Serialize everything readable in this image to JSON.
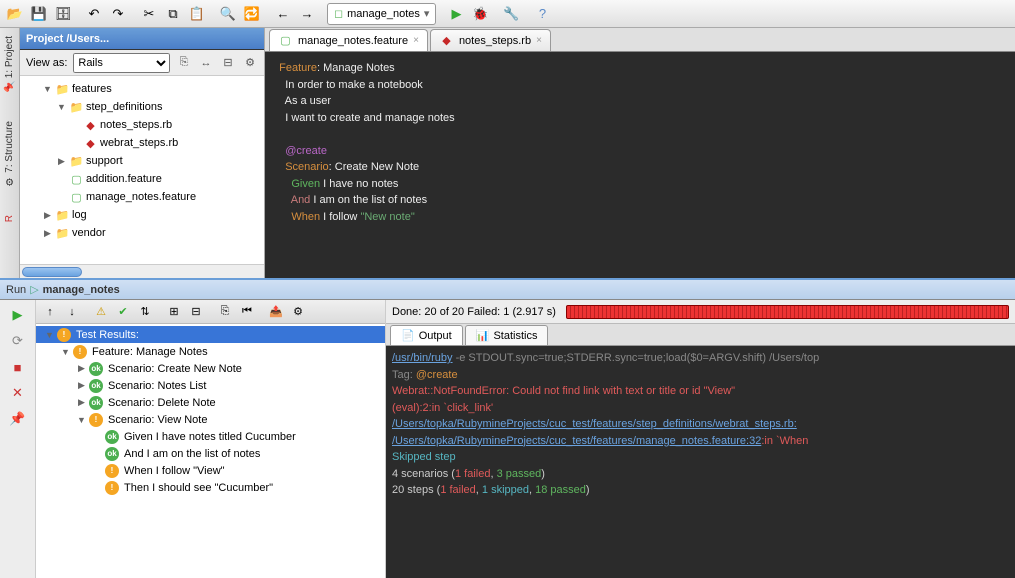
{
  "toolbar": {
    "run_config": "manage_notes"
  },
  "project": {
    "header": "Project /Users...",
    "view_as_label": "View as:",
    "view_as_value": "Rails",
    "tree": [
      {
        "d": 1,
        "exp": "▼",
        "icon": "folder",
        "label": "features"
      },
      {
        "d": 2,
        "exp": "▼",
        "icon": "folder",
        "label": "step_definitions"
      },
      {
        "d": 3,
        "exp": "",
        "icon": "ruby",
        "label": "notes_steps.rb"
      },
      {
        "d": 3,
        "exp": "",
        "icon": "ruby",
        "label": "webrat_steps.rb"
      },
      {
        "d": 2,
        "exp": "▶",
        "icon": "folder",
        "label": "support"
      },
      {
        "d": 2,
        "exp": "",
        "icon": "feature",
        "label": "addition.feature"
      },
      {
        "d": 2,
        "exp": "",
        "icon": "feature",
        "label": "manage_notes.feature"
      },
      {
        "d": 1,
        "exp": "▶",
        "icon": "folder",
        "label": "log"
      },
      {
        "d": 1,
        "exp": "▶",
        "icon": "folder-y",
        "label": "vendor"
      }
    ]
  },
  "editor": {
    "tabs": [
      {
        "icon": "feature",
        "label": "manage_notes.feature",
        "active": true
      },
      {
        "icon": "ruby",
        "label": "notes_steps.rb",
        "active": false
      }
    ],
    "lines": [
      {
        "segs": [
          {
            "c": "kw-feature",
            "t": "  Feature"
          },
          {
            "c": "kw-text",
            "t": ": Manage Notes"
          }
        ]
      },
      {
        "segs": [
          {
            "c": "kw-text",
            "t": "    In order to make a notebook"
          }
        ]
      },
      {
        "segs": [
          {
            "c": "kw-text",
            "t": "    As a user"
          }
        ]
      },
      {
        "segs": [
          {
            "c": "kw-text",
            "t": "    I want to create and manage notes"
          }
        ]
      },
      {
        "segs": [
          {
            "c": "",
            "t": " "
          }
        ]
      },
      {
        "segs": [
          {
            "c": "kw-tag",
            "t": "    @create"
          }
        ]
      },
      {
        "segs": [
          {
            "c": "kw-scenario",
            "t": "    Scenario"
          },
          {
            "c": "kw-text",
            "t": ": Create New Note"
          }
        ]
      },
      {
        "segs": [
          {
            "c": "kw-given",
            "t": "      Given "
          },
          {
            "c": "kw-text",
            "t": "I have no notes"
          }
        ]
      },
      {
        "segs": [
          {
            "c": "kw-and",
            "t": "      And "
          },
          {
            "c": "kw-text",
            "t": "I am on the list of notes"
          }
        ]
      },
      {
        "segs": [
          {
            "c": "kw-when",
            "t": "      When "
          },
          {
            "c": "kw-text",
            "t": "I follow "
          },
          {
            "c": "kw-string",
            "t": "\"New note\""
          }
        ]
      }
    ]
  },
  "run": {
    "header_prefix": "Run",
    "header_name": "manage_notes",
    "done": "Done: 20 of 20  Failed: 1  (2.917 s)",
    "out_tabs": [
      "Output",
      "Statistics"
    ],
    "tree": [
      {
        "d": 0,
        "exp": "▼",
        "st": "warn",
        "label": "Test Results:",
        "sel": true
      },
      {
        "d": 1,
        "exp": "▼",
        "st": "warn",
        "label": "Feature: Manage Notes"
      },
      {
        "d": 2,
        "exp": "▶",
        "st": "ok",
        "label": "Scenario: Create New Note"
      },
      {
        "d": 2,
        "exp": "▶",
        "st": "ok",
        "label": "Scenario: Notes List"
      },
      {
        "d": 2,
        "exp": "▶",
        "st": "ok",
        "label": "Scenario: Delete Note"
      },
      {
        "d": 2,
        "exp": "▼",
        "st": "warn",
        "label": "Scenario: View Note"
      },
      {
        "d": 3,
        "exp": "",
        "st": "ok",
        "label": "Given I have notes titled Cucumber"
      },
      {
        "d": 3,
        "exp": "",
        "st": "ok",
        "label": "And I am on the list of notes"
      },
      {
        "d": 3,
        "exp": "",
        "st": "warn",
        "label": "When I follow \"View\""
      },
      {
        "d": 3,
        "exp": "",
        "st": "warn",
        "label": "Then I should see \"Cucumber\""
      }
    ],
    "console": [
      {
        "segs": [
          {
            "c": "c-link",
            "t": "/usr/bin/ruby"
          },
          {
            "c": "c-gray",
            "t": " -e STDOUT.sync=true;STDERR.sync=true;load($0=ARGV.shift) /Users/top"
          }
        ]
      },
      {
        "segs": [
          {
            "c": "c-gray",
            "t": "Tag: "
          },
          {
            "c": "c-orange",
            "t": "@create"
          }
        ]
      },
      {
        "segs": [
          {
            "c": "",
            "t": " "
          }
        ]
      },
      {
        "segs": [
          {
            "c": "c-red",
            "t": "Webrat::NotFoundError: Could not find link with text or title or id \"View\""
          }
        ]
      },
      {
        "segs": [
          {
            "c": "c-red",
            "t": "(eval):2:in `click_link'"
          }
        ]
      },
      {
        "segs": [
          {
            "c": "c-link",
            "t": "/Users/topka/RubymineProjects/cuc_test/features/step_definitions/webrat_steps.rb:"
          }
        ]
      },
      {
        "segs": [
          {
            "c": "c-link",
            "t": "/Users/topka/RubymineProjects/cuc_test/features/manage_notes.feature:32"
          },
          {
            "c": "c-red",
            "t": ":in `When "
          }
        ]
      },
      {
        "segs": [
          {
            "c": "",
            "t": " "
          }
        ]
      },
      {
        "segs": [
          {
            "c": "c-cyan",
            "t": "Skipped step"
          }
        ]
      },
      {
        "segs": [
          {
            "c": "",
            "t": "4 scenarios ("
          },
          {
            "c": "c-red",
            "t": "1 failed"
          },
          {
            "c": "",
            "t": ", "
          },
          {
            "c": "c-green",
            "t": "3 passed"
          },
          {
            "c": "",
            "t": ")"
          }
        ]
      },
      {
        "segs": [
          {
            "c": "",
            "t": "20 steps ("
          },
          {
            "c": "c-red",
            "t": "1 failed"
          },
          {
            "c": "",
            "t": ", "
          },
          {
            "c": "c-cyan",
            "t": "1 skipped"
          },
          {
            "c": "",
            "t": ", "
          },
          {
            "c": "c-green",
            "t": "18 passed"
          },
          {
            "c": "",
            "t": ")"
          }
        ]
      }
    ]
  }
}
